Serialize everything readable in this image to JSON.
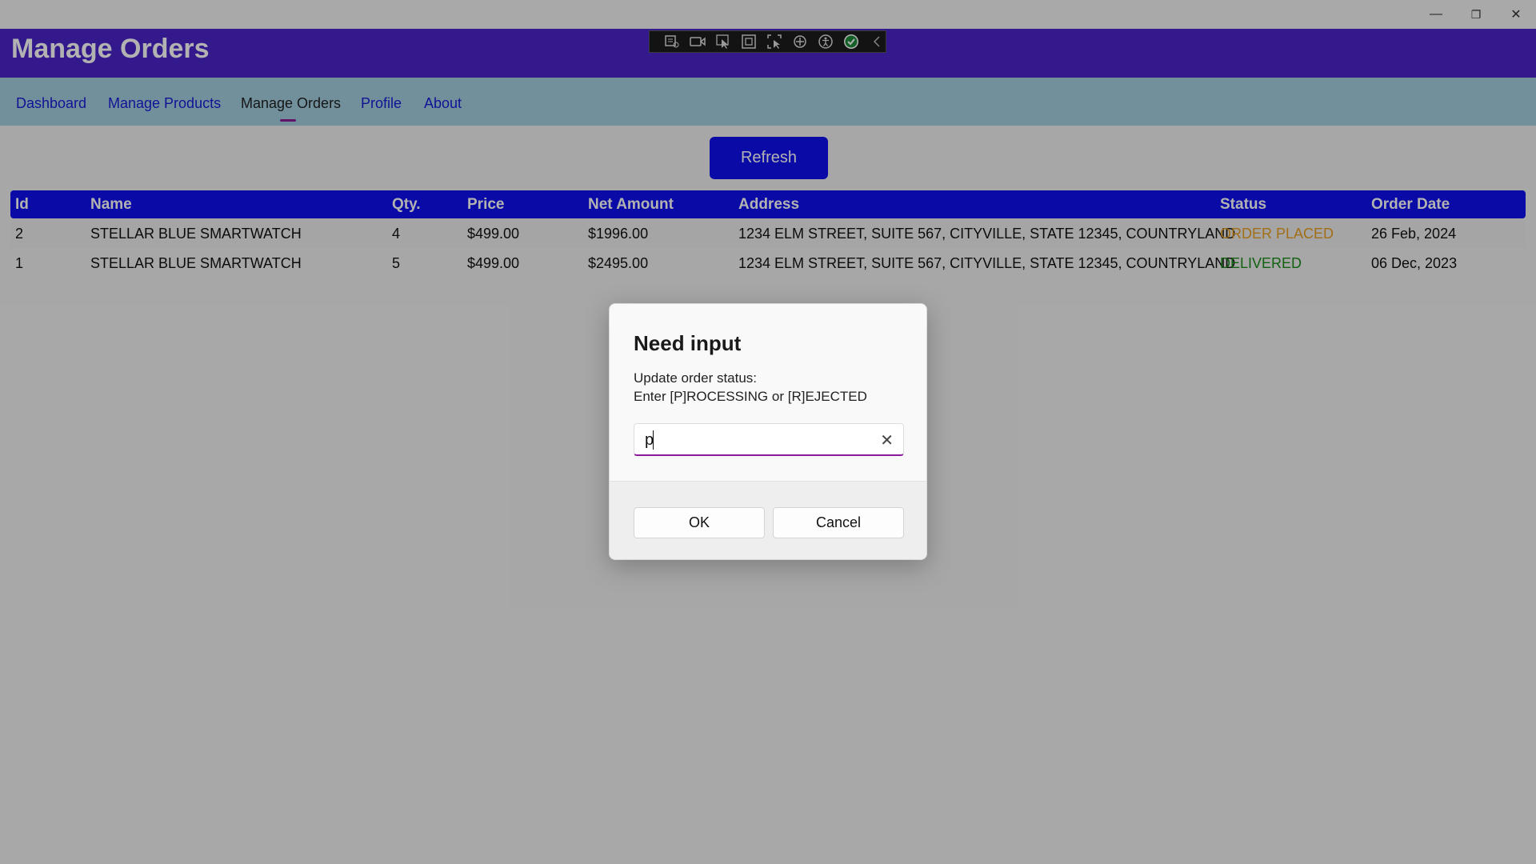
{
  "window": {
    "controls": {
      "minimize": "—",
      "maximize": "❐",
      "close": "✕"
    }
  },
  "header": {
    "title": "Manage Orders"
  },
  "debug_toolbar": {
    "icons": [
      "live-visual-tree-icon",
      "record-icon",
      "select-element-icon",
      "display-layout-adorners-icon",
      "track-focus-icon",
      "binding-failures-icon",
      "accessibility-icon",
      "hot-reload-ok-icon",
      "collapse-toolbar-icon"
    ]
  },
  "nav": {
    "items": [
      {
        "label": "Dashboard"
      },
      {
        "label": "Manage Products"
      },
      {
        "label": "Manage Orders",
        "active": true
      },
      {
        "label": "Profile"
      },
      {
        "label": "About"
      }
    ]
  },
  "toolbar": {
    "refresh_label": "Refresh"
  },
  "table": {
    "columns": [
      "Id",
      "Name",
      "Qty.",
      "Price",
      "Net Amount",
      "Address",
      "Status",
      "Order Date"
    ],
    "rows": [
      {
        "id": "2",
        "name": "STELLAR BLUE SMARTWATCH",
        "qty": "4",
        "price": "$499.00",
        "net": "$1996.00",
        "address": "1234 ELM STREET, SUITE 567, CITYVILLE, STATE 12345, COUNTRYLAND",
        "status": "ORDER PLACED",
        "date": "26 Feb, 2024"
      },
      {
        "id": "1",
        "name": "STELLAR BLUE SMARTWATCH",
        "qty": "5",
        "price": "$499.00",
        "net": "$2495.00",
        "address": "1234 ELM STREET, SUITE 567, CITYVILLE, STATE 12345, COUNTRYLAND",
        "status": "DELIVERED",
        "date": "06 Dec, 2023"
      }
    ]
  },
  "dialog": {
    "title": "Need input",
    "message_line1": "Update order status:",
    "message_line2": "Enter [P]ROCESSING or [R]EJECTED",
    "input_value": "p",
    "clear_glyph": "✕",
    "ok_label": "OK",
    "cancel_label": "Cancel"
  },
  "colors": {
    "header": "#4a25c9",
    "nav": "#a3cfe0",
    "accent_blue": "#0f0ff0",
    "status_placed": "#e8a020",
    "status_delivered": "#1a8a1a",
    "focus_underline": "#8b1a9a"
  }
}
